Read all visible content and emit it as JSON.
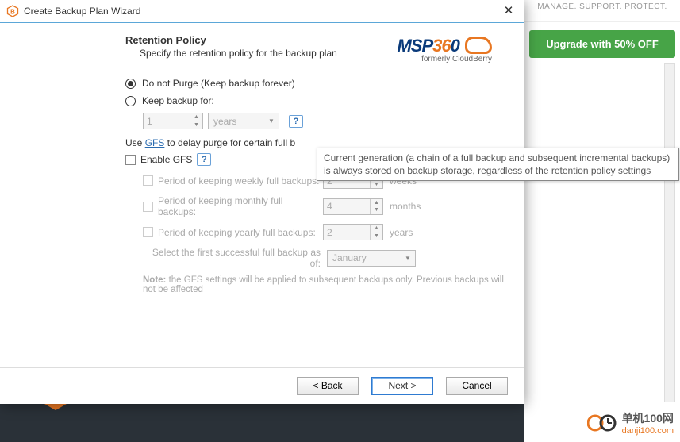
{
  "bg_hex_color": "#2a3138",
  "dialog": {
    "title": "Create Backup Plan Wizard",
    "header_title": "Retention Policy",
    "header_sub": "Specify the retention policy for the backup plan",
    "logo_brand": "MSP",
    "logo_num": "36",
    "logo_tail": "0",
    "logo_sub": "formerly CloudBerry"
  },
  "options": {
    "do_not_purge": "Do not Purge (Keep backup forever)",
    "keep_for": "Keep backup for:",
    "keep_value": "1",
    "keep_unit": "years",
    "gfs_line_pre": "Use ",
    "gfs_link": "GFS",
    "gfs_line_post": " to delay purge for certain full b",
    "enable_gfs": "Enable GFS"
  },
  "gfs": {
    "weekly_label": "Period of keeping weekly full backups:",
    "weekly_val": "2",
    "weekly_unit": "weeks",
    "monthly_label": "Period of keeping monthly full backups:",
    "monthly_val": "4",
    "monthly_unit": "months",
    "yearly_label": "Period of keeping yearly full backups:",
    "yearly_val": "2",
    "yearly_unit": "years",
    "select_first_label": "Select the first successful full backup as of:",
    "select_first_val": "January",
    "note_b": "Note:",
    "note_text": "  the GFS settings will be applied to subsequent backups only. Previous backups will not be affected"
  },
  "tooltip": "Current generation (a chain of a full backup and subsequent incremental backups) is always stored on backup storage, regardless of the retention policy settings",
  "buttons": {
    "back": "< Back",
    "next": "Next >",
    "cancel": "Cancel"
  },
  "right": {
    "tag": "MANAGE. SUPPORT. PROTECT.",
    "upgrade": "Upgrade with 50% OFF"
  },
  "watermark": {
    "line1": "单机100网",
    "line2": "danji100.com"
  }
}
